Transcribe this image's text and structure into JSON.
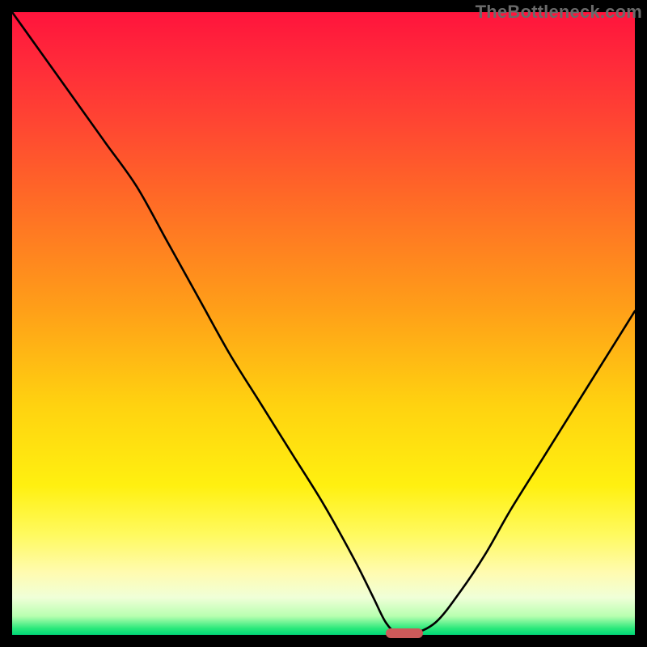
{
  "watermark_text": "TheBottleneck.com",
  "chart_data": {
    "type": "line",
    "title": "",
    "xlabel": "",
    "ylabel": "",
    "xlim": [
      0,
      100
    ],
    "ylim": [
      0,
      100
    ],
    "x": [
      0,
      5,
      10,
      15,
      20,
      25,
      30,
      35,
      40,
      45,
      50,
      55,
      58,
      60,
      62,
      64,
      68,
      72,
      76,
      80,
      85,
      90,
      95,
      100
    ],
    "values": [
      100,
      93,
      86,
      79,
      72,
      63,
      54,
      45,
      37,
      29,
      21,
      12,
      6,
      2,
      0,
      0,
      2,
      7,
      13,
      20,
      28,
      36,
      44,
      52
    ],
    "minimum_marker": {
      "x_start": 60,
      "x_end": 66,
      "y": 0
    },
    "gradient_stops": [
      {
        "pos": 0,
        "color": "#ff143c"
      },
      {
        "pos": 50,
        "color": "#ffb814"
      },
      {
        "pos": 80,
        "color": "#fff040"
      },
      {
        "pos": 100,
        "color": "#00d878"
      }
    ]
  }
}
